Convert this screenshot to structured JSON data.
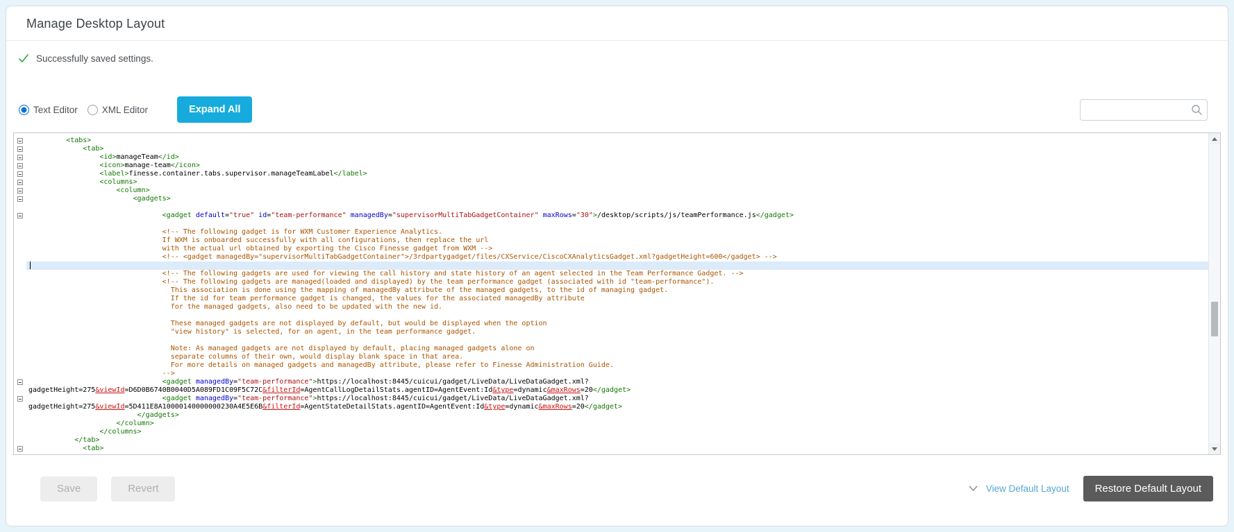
{
  "page": {
    "title": "Manage Desktop Layout"
  },
  "alert": {
    "message": "Successfully saved settings.",
    "icon": "check-icon"
  },
  "toolbar": {
    "radio_text_editor": "Text Editor",
    "radio_xml_editor": "XML Editor",
    "selected_editor": "Text Editor",
    "expand_all_label": "Expand All"
  },
  "search": {
    "value": "",
    "placeholder": "",
    "icon": "search-icon"
  },
  "colors": {
    "accent_cyan": "#16abdc",
    "success_green": "#3dae49",
    "radio_blue": "#0b72d4",
    "link_blue": "#56a7d8",
    "restore_gray": "#5b5b5b",
    "cursor_line": "#dcebf9",
    "syntax_tag": "#117700",
    "syntax_attribute": "#0000cc",
    "syntax_string": "#aa1111",
    "syntax_comment": "#aa5500",
    "syntax_entity": "#cc1111"
  },
  "editor": {
    "lines": [
      {
        "ind": 9,
        "fold": true,
        "seg": [
          [
            "tag",
            "<tabs>"
          ]
        ]
      },
      {
        "ind": 13,
        "fold": true,
        "seg": [
          [
            "tag",
            "<tab>"
          ]
        ]
      },
      {
        "ind": 17,
        "fold": true,
        "seg": [
          [
            "tag",
            "<id>"
          ],
          [
            "txt",
            "manageTeam"
          ],
          [
            "tag",
            "</id>"
          ]
        ]
      },
      {
        "ind": 17,
        "fold": true,
        "seg": [
          [
            "tag",
            "<icon>"
          ],
          [
            "txt",
            "manage-team"
          ],
          [
            "tag",
            "</icon>"
          ]
        ]
      },
      {
        "ind": 17,
        "fold": true,
        "seg": [
          [
            "tag",
            "<label>"
          ],
          [
            "txt",
            "finesse.container.tabs.supervisor.manageTeamLabel"
          ],
          [
            "tag",
            "</label>"
          ]
        ]
      },
      {
        "ind": 17,
        "fold": true,
        "seg": [
          [
            "tag",
            "<columns>"
          ]
        ]
      },
      {
        "ind": 21,
        "fold": true,
        "seg": [
          [
            "tag",
            "<column>"
          ]
        ]
      },
      {
        "ind": 25,
        "fold": true,
        "seg": [
          [
            "tag",
            "<gadgets>"
          ]
        ]
      },
      {
        "ind": 0,
        "seg": []
      },
      {
        "ind": 32,
        "fold": true,
        "seg": [
          [
            "tag",
            "<gadget "
          ],
          [
            "attr",
            "default"
          ],
          [
            "txt",
            "="
          ],
          [
            "str",
            "\"true\""
          ],
          [
            "txt",
            " "
          ],
          [
            "attr",
            "id"
          ],
          [
            "txt",
            "="
          ],
          [
            "str",
            "\"team-performance\""
          ],
          [
            "txt",
            " "
          ],
          [
            "attr",
            "managedBy"
          ],
          [
            "txt",
            "="
          ],
          [
            "str",
            "\"supervisorMultiTabGadgetContainer\""
          ],
          [
            "txt",
            " "
          ],
          [
            "attr",
            "maxRows"
          ],
          [
            "txt",
            "="
          ],
          [
            "str",
            "\"30\""
          ],
          [
            "tag",
            ">"
          ],
          [
            "txt",
            "/desktop/scripts/js/teamPerformance.js"
          ],
          [
            "tag",
            "</gadget>"
          ]
        ]
      },
      {
        "ind": 0,
        "seg": []
      },
      {
        "ind": 32,
        "seg": [
          [
            "com",
            "<!-- The following gadget is for WXM Customer Experience Analytics."
          ]
        ]
      },
      {
        "ind": 32,
        "seg": [
          [
            "com",
            "If WXM is onboarded successfully with all configurations, then replace the url"
          ]
        ]
      },
      {
        "ind": 32,
        "seg": [
          [
            "com",
            "with the actual url obtained by exporting the Cisco Finesse gadget from WXM -->"
          ]
        ]
      },
      {
        "ind": 32,
        "seg": [
          [
            "com",
            "<!-- <gadget managedBy=\"supervisorMultiTabGadgetContainer\">/3rdpartygadget/files/CXService/CiscoCXAnalyticsGadget.xml?gadgetHeight=600</gadget> -->"
          ]
        ]
      },
      {
        "ind": 0,
        "hl": true,
        "cur": true,
        "seg": []
      },
      {
        "ind": 32,
        "seg": [
          [
            "com",
            "<!-- The following gadgets are used for viewing the call history and state history of an agent selected in the Team Performance Gadget. -->"
          ]
        ]
      },
      {
        "ind": 32,
        "seg": [
          [
            "com",
            "<!-- The following gadgets are managed(loaded and displayed) by the team performance gadget (associated with id \"team-performance\")."
          ]
        ]
      },
      {
        "ind": 34,
        "seg": [
          [
            "com",
            "This association is done using the mapping of managedBy attribute of the managed gadgets, to the id of managing gadget."
          ]
        ]
      },
      {
        "ind": 34,
        "seg": [
          [
            "com",
            "If the id for team performance gadget is changed, the values for the associated managedBy attribute"
          ]
        ]
      },
      {
        "ind": 34,
        "seg": [
          [
            "com",
            "for the managed gadgets, also need to be updated with the new id."
          ]
        ]
      },
      {
        "ind": 0,
        "seg": []
      },
      {
        "ind": 34,
        "seg": [
          [
            "com",
            "These managed gadgets are not displayed by default, but would be displayed when the option"
          ]
        ]
      },
      {
        "ind": 34,
        "seg": [
          [
            "com",
            "\"view history\" is selected, for an agent, in the team performance gadget."
          ]
        ]
      },
      {
        "ind": 0,
        "seg": []
      },
      {
        "ind": 34,
        "seg": [
          [
            "com",
            "Note: As managed gadgets are not displayed by default, placing managed gadgets alone on"
          ]
        ]
      },
      {
        "ind": 34,
        "seg": [
          [
            "com",
            "separate columns of their own, would display blank space in that area."
          ]
        ]
      },
      {
        "ind": 34,
        "seg": [
          [
            "com",
            "For more details on managed gadgets and managedBy attribute, please refer to Finesse Administration Guide."
          ]
        ]
      },
      {
        "ind": 32,
        "seg": [
          [
            "com",
            "-->"
          ]
        ]
      },
      {
        "ind": 32,
        "fold": true,
        "seg": [
          [
            "tag",
            "<gadget "
          ],
          [
            "attr",
            "managedBy"
          ],
          [
            "txt",
            "="
          ],
          [
            "str",
            "\"team-performance\""
          ],
          [
            "tag",
            ">"
          ],
          [
            "txt",
            "https://localhost:8445/cuicui/gadget/LiveData/LiveDataGadget.xml?"
          ]
        ]
      },
      {
        "ind": 0,
        "seg": [
          [
            "txt",
            "gadgetHeight=275"
          ],
          [
            "ent",
            "&viewId"
          ],
          [
            "txt",
            "=D6D0B6740B0040D5A089FD1C09F5C72C"
          ],
          [
            "ent",
            "&filterId"
          ],
          [
            "txt",
            "=AgentCallLogDetailStats.agentID=AgentEvent:Id"
          ],
          [
            "ent",
            "&type"
          ],
          [
            "txt",
            "=dynamic"
          ],
          [
            "ent",
            "&maxRows"
          ],
          [
            "txt",
            "=20"
          ],
          [
            "tag",
            "</gadget>"
          ]
        ]
      },
      {
        "ind": 32,
        "fold": true,
        "seg": [
          [
            "tag",
            "<gadget "
          ],
          [
            "attr",
            "managedBy"
          ],
          [
            "txt",
            "="
          ],
          [
            "str",
            "\"team-performance\""
          ],
          [
            "tag",
            ">"
          ],
          [
            "txt",
            "https://localhost:8445/cuicui/gadget/LiveData/LiveDataGadget.xml?"
          ]
        ]
      },
      {
        "ind": 0,
        "seg": [
          [
            "txt",
            "gadgetHeight=275"
          ],
          [
            "ent",
            "&viewId"
          ],
          [
            "txt",
            "=5D411E8A10000140000000230A4E5E6B"
          ],
          [
            "ent",
            "&filterId"
          ],
          [
            "txt",
            "=AgentStateDetailStats.agentID=AgentEvent:Id"
          ],
          [
            "ent",
            "&type"
          ],
          [
            "txt",
            "=dynamic"
          ],
          [
            "ent",
            "&maxRows"
          ],
          [
            "txt",
            "=20"
          ],
          [
            "tag",
            "</gadget>"
          ]
        ]
      },
      {
        "ind": 26,
        "seg": [
          [
            "tag",
            "</gadgets>"
          ]
        ]
      },
      {
        "ind": 21,
        "seg": [
          [
            "tag",
            "</column>"
          ]
        ]
      },
      {
        "ind": 17,
        "seg": [
          [
            "tag",
            "</columns>"
          ]
        ]
      },
      {
        "ind": 11,
        "seg": [
          [
            "tag",
            "</tab>"
          ]
        ]
      },
      {
        "ind": 13,
        "fold": true,
        "seg": [
          [
            "tag",
            "<tab>"
          ]
        ]
      }
    ]
  },
  "footer": {
    "save_label": "Save",
    "revert_label": "Revert",
    "view_default_label": "View Default Layout",
    "restore_default_label": "Restore Default Layout"
  }
}
